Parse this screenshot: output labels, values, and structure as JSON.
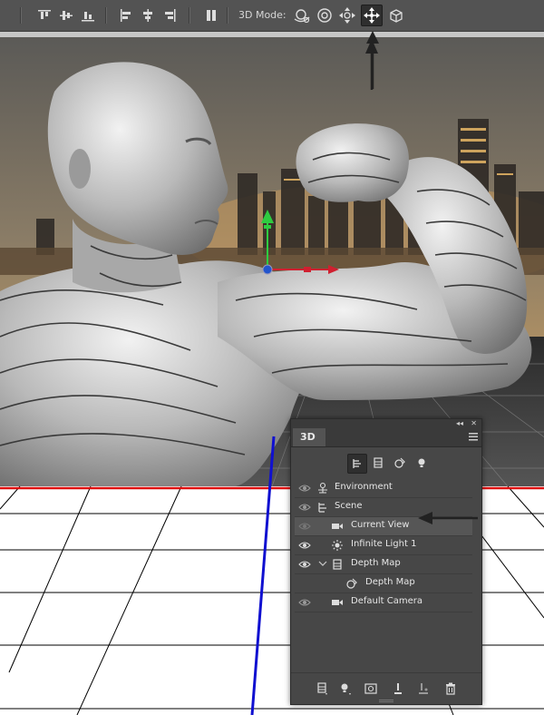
{
  "toolbar": {
    "mode_label": "3D Mode:",
    "align_icons": [
      "align-top-edges-icon",
      "align-vertical-centers-icon",
      "align-bottom-edges-icon",
      "align-left-edges-icon",
      "align-horizontal-centers-icon",
      "align-right-edges-icon",
      "auto-align-layers-icon"
    ],
    "mode_icons": [
      "orbit-3d-icon",
      "roll-3d-icon",
      "drag-3d-icon",
      "slide-3d-icon",
      "scale-3d-icon"
    ],
    "active_mode": "slide-3d-icon"
  },
  "panel": {
    "tab_label": "3D",
    "collapse_glyph": "◂◂",
    "close_glyph": "✕",
    "filter_icons": [
      "whole-scene-icon",
      "meshes-icon",
      "materials-icon",
      "lights-icon"
    ],
    "layers": [
      {
        "label": "Environment",
        "icon": "environment-icon",
        "indent": 0,
        "visible": true
      },
      {
        "label": "Scene",
        "icon": "scene-icon",
        "indent": 0,
        "visible": true
      },
      {
        "label": "Current View",
        "icon": "camera-icon",
        "indent": 1,
        "visible": true,
        "selected": true
      },
      {
        "label": "Infinite Light 1",
        "icon": "light-icon",
        "indent": 1,
        "visible": true
      },
      {
        "label": "Depth Map",
        "icon": "mesh-icon",
        "indent": 1,
        "visible": true,
        "expanded": true
      },
      {
        "label": "Depth Map",
        "icon": "material-icon",
        "indent": 2,
        "visible": true
      },
      {
        "label": "Default Camera",
        "icon": "camera-icon",
        "indent": 1,
        "visible": true
      }
    ],
    "bottom_icons": [
      "add-mesh-icon",
      "add-light-icon",
      "render-icon",
      "drop-to-plane-icon",
      "ground-shadow-icon",
      "delete-icon"
    ]
  },
  "colors": {
    "toolbar_bg": "#535353",
    "panel_bg": "#474747",
    "selected_row": "#565656",
    "ground_line_red": "#e01010",
    "axis_blue": "#1010d0",
    "gizmo_green": "#2ecc40",
    "gizmo_red": "#d02030"
  }
}
